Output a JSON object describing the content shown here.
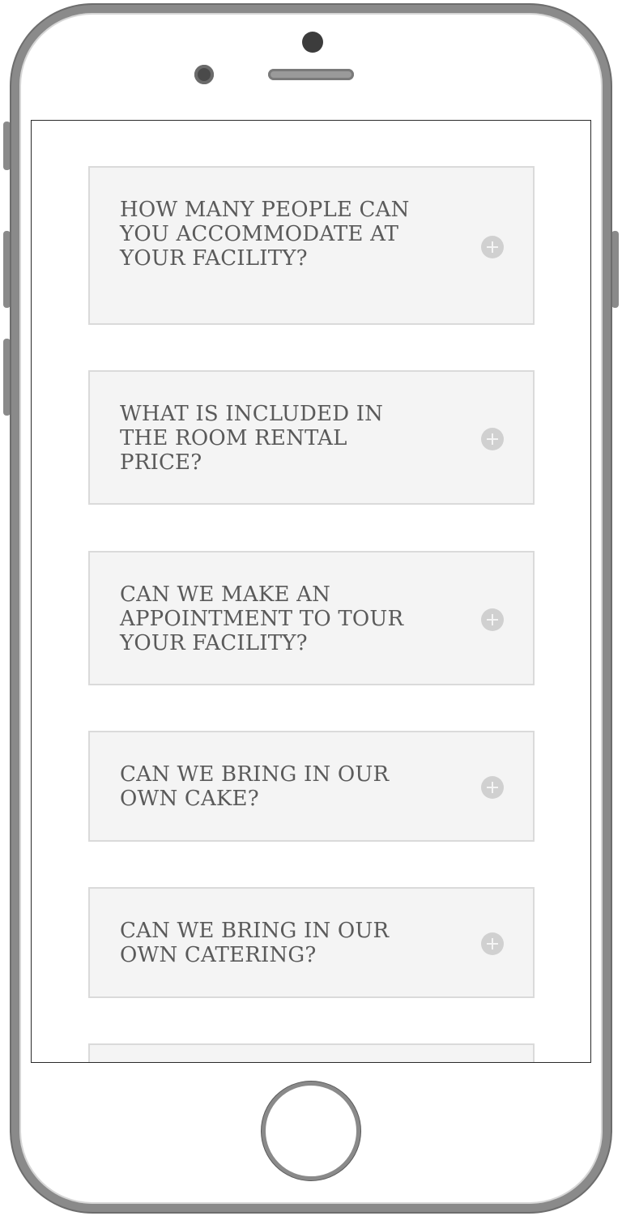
{
  "faq": {
    "items": [
      {
        "question": "HOW MANY PEOPLE CAN YOU ACCOMMODATE AT YOUR FACILITY?",
        "expand_icon": "plus-circle-icon"
      },
      {
        "question": "WHAT IS INCLUDED IN THE ROOM RENTAL PRICE?",
        "expand_icon": "plus-circle-icon"
      },
      {
        "question": "CAN WE MAKE AN APPOINTMENT TO TOUR YOUR FACILITY?",
        "expand_icon": "plus-circle-icon"
      },
      {
        "question": "CAN WE BRING IN OUR OWN CAKE?",
        "expand_icon": "plus-circle-icon"
      },
      {
        "question": "CAN WE BRING IN OUR OWN CATERING?",
        "expand_icon": "plus-circle-icon"
      },
      {
        "question": "",
        "expand_icon": ""
      }
    ]
  },
  "colors": {
    "item_background": "#f4f4f4",
    "item_border": "#dadada",
    "question_text": "#5a5a5a",
    "icon": "#d0d0d0",
    "device_frame": "#8a8a8a"
  }
}
